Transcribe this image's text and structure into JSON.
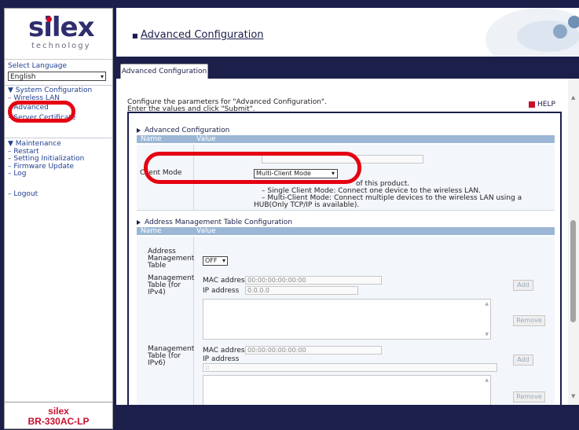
{
  "brand": {
    "logo": "silex",
    "tagline": "technology",
    "model_line1": "silex",
    "model_line2": "BR-330AC-LP"
  },
  "language": {
    "label": "Select Language",
    "selected": "English"
  },
  "menu": {
    "system_config": "▼ System Configuration",
    "system_items": [
      "– Wireless LAN",
      "– Advanced",
      "– Server Certificate"
    ],
    "maintenance": "▼ Maintenance",
    "maintenance_items": [
      "– Restart",
      "– Setting Initialization",
      "– Firmware Update",
      "– Log"
    ],
    "logout": "– Logout"
  },
  "header": {
    "icon": "■",
    "title": "Advanced Configuration"
  },
  "tab": {
    "label": "Advanced Configuration"
  },
  "intro": {
    "line1": "Configure the parameters for \"Advanced Configuration\".",
    "line2": "Enter the values and click \"Submit\"."
  },
  "help": {
    "label": "HELP"
  },
  "advanced": {
    "title": "Advanced Configuration",
    "col_name": "Name",
    "col_value": "Value",
    "client_mode_label": "Client Mode",
    "client_mode_value": "Multi-Client Mode",
    "note1": "of this product.",
    "note2": "– Single Client Mode: Connect one device to the wireless LAN.",
    "note3": "– Multi-Client Mode: Connect multiple devices to the wireless LAN using a",
    "note4": "HUB(Only TCP/IP is available)."
  },
  "addr_table": {
    "title": "Address Management Table Configuration",
    "col_name": "Name",
    "col_value": "Value",
    "amt_label1": "Address",
    "amt_label2": "Management",
    "amt_label3": "Table",
    "amt_value": "OFF",
    "ipv4_label1": "Management",
    "ipv4_label2": "Table (for",
    "ipv4_label3": "IPv4)",
    "mac_label": "MAC address",
    "mac_value": "00:00:00:00:00:00",
    "ip_label": "IP address",
    "ipv4_value": "0.0.0.0",
    "add_label": "Add",
    "remove_label": "Remove",
    "ipv6_label1": "Management",
    "ipv6_label2": "Table (for",
    "ipv6_label3": "IPv6)",
    "mac_value_v6": "00:00:00:00:00:00",
    "ipv6_value": "::"
  }
}
